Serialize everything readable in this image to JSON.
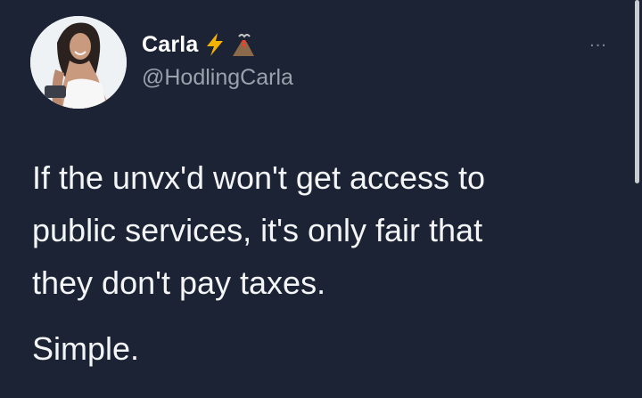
{
  "tweet": {
    "display_name": "Carla",
    "name_emojis": [
      "lightning-bolt-emoji",
      "volcano-emoji"
    ],
    "handle": "@HodlingCarla",
    "more_label": "...",
    "body_line1": "If the unvx'd won't get access to\npublic services, it's only fair that\nthey don't pay taxes.",
    "body_line2": "Simple."
  },
  "colors": {
    "background": "#1b2334",
    "text": "#f4f5f7",
    "handle": "#9aa3ad",
    "bolt": "#f5b301"
  }
}
